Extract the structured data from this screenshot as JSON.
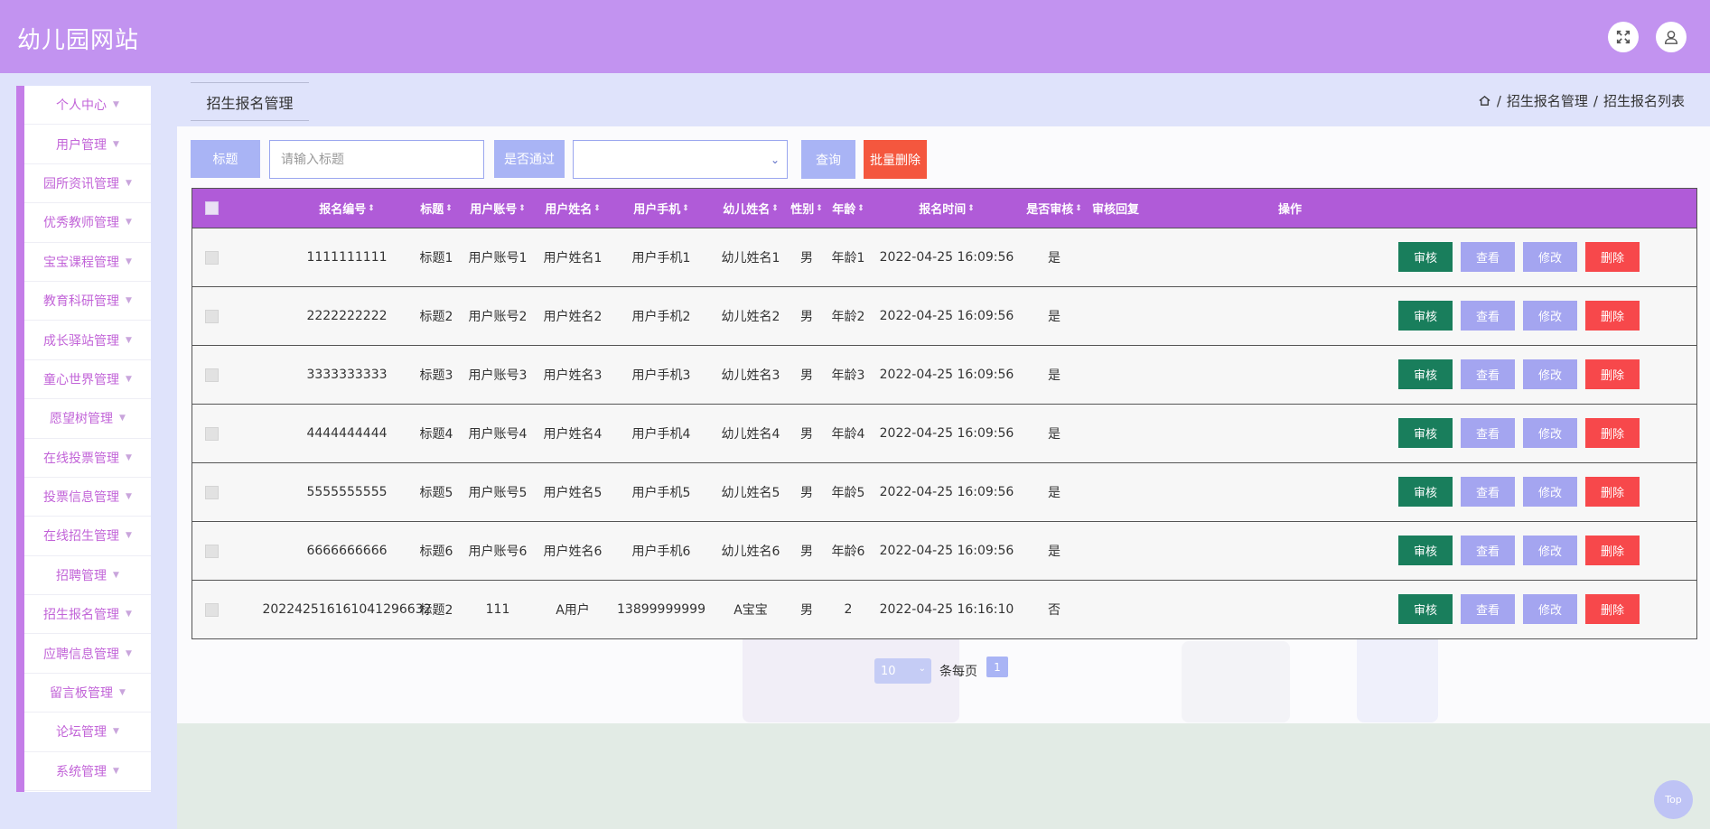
{
  "app": {
    "title": "幼儿园网站"
  },
  "header": {
    "fullscreen_icon": "expand-icon",
    "user_icon": "user-icon"
  },
  "sidebar": {
    "items": [
      {
        "label": "个人中心"
      },
      {
        "label": "用户管理"
      },
      {
        "label": "园所资讯管理"
      },
      {
        "label": "优秀教师管理"
      },
      {
        "label": "宝宝课程管理"
      },
      {
        "label": "教育科研管理"
      },
      {
        "label": "成长驿站管理"
      },
      {
        "label": "童心世界管理"
      },
      {
        "label": "愿望树管理"
      },
      {
        "label": "在线投票管理"
      },
      {
        "label": "投票信息管理"
      },
      {
        "label": "在线招生管理"
      },
      {
        "label": "招聘管理"
      },
      {
        "label": "招生报名管理"
      },
      {
        "label": "应聘信息管理"
      },
      {
        "label": "留言板管理"
      },
      {
        "label": "论坛管理"
      },
      {
        "label": "系统管理"
      }
    ]
  },
  "page": {
    "tab_title": "招生报名管理",
    "breadcrumb": [
      "招生报名管理",
      "招生报名列表"
    ]
  },
  "search": {
    "title_label": "标题",
    "title_placeholder": "请输入标题",
    "passed_label": "是否通过",
    "query_label": "查询",
    "bulk_delete_label": "批量删除"
  },
  "table": {
    "columns": [
      "报名编号",
      "标题",
      "用户账号",
      "用户姓名",
      "用户手机",
      "幼儿姓名",
      "性别",
      "年龄",
      "报名时间",
      "是否审核",
      "审核回复",
      "操作"
    ],
    "rows": [
      {
        "id": "1111111111",
        "title": "标题1",
        "account": "用户账号1",
        "name": "用户姓名1",
        "phone": "用户手机1",
        "child": "幼儿姓名1",
        "gender": "男",
        "age": "年龄1",
        "time": "2022-04-25 16:09:56",
        "audited": "是",
        "reply": ""
      },
      {
        "id": "2222222222",
        "title": "标题2",
        "account": "用户账号2",
        "name": "用户姓名2",
        "phone": "用户手机2",
        "child": "幼儿姓名2",
        "gender": "男",
        "age": "年龄2",
        "time": "2022-04-25 16:09:56",
        "audited": "是",
        "reply": ""
      },
      {
        "id": "3333333333",
        "title": "标题3",
        "account": "用户账号3",
        "name": "用户姓名3",
        "phone": "用户手机3",
        "child": "幼儿姓名3",
        "gender": "男",
        "age": "年龄3",
        "time": "2022-04-25 16:09:56",
        "audited": "是",
        "reply": ""
      },
      {
        "id": "4444444444",
        "title": "标题4",
        "account": "用户账号4",
        "name": "用户姓名4",
        "phone": "用户手机4",
        "child": "幼儿姓名4",
        "gender": "男",
        "age": "年龄4",
        "time": "2022-04-25 16:09:56",
        "audited": "是",
        "reply": ""
      },
      {
        "id": "5555555555",
        "title": "标题5",
        "account": "用户账号5",
        "name": "用户姓名5",
        "phone": "用户手机5",
        "child": "幼儿姓名5",
        "gender": "男",
        "age": "年龄5",
        "time": "2022-04-25 16:09:56",
        "audited": "是",
        "reply": ""
      },
      {
        "id": "6666666666",
        "title": "标题6",
        "account": "用户账号6",
        "name": "用户姓名6",
        "phone": "用户手机6",
        "child": "幼儿姓名6",
        "gender": "男",
        "age": "年龄6",
        "time": "2022-04-25 16:09:56",
        "audited": "是",
        "reply": ""
      },
      {
        "id": "20224251616104129663​2",
        "title": "标题2",
        "account": "111",
        "name": "A用户",
        "phone": "13899999999",
        "child": "A宝宝",
        "gender": "男",
        "age": "2",
        "time": "2022-04-25 16:16:10",
        "audited": "否",
        "reply": ""
      }
    ],
    "actions": {
      "audit": "审核",
      "view": "查看",
      "edit": "修改",
      "delete": "删除"
    }
  },
  "pager": {
    "page_size": "10",
    "per_page_label": "条每页",
    "current_page": "1"
  },
  "back_to_top": "Top",
  "colors": {
    "header": "#c293f0",
    "table_header": "#b05bd8",
    "audit": "#197e5c",
    "view": "#a4a5f0",
    "delete": "#f7484b"
  }
}
